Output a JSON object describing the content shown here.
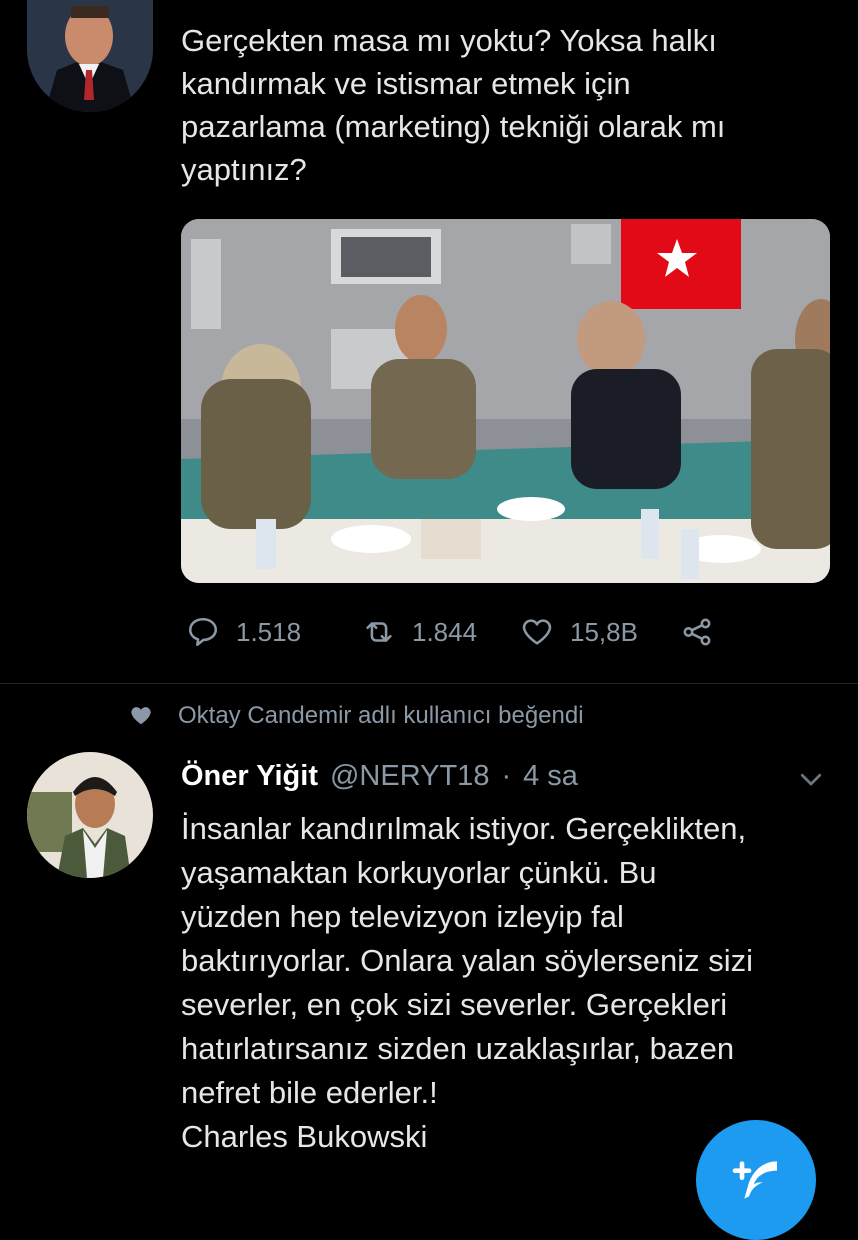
{
  "tweet1": {
    "text": "Gerçekten masa mı yoktu? Yoksa halkı\nkandırmak ve istismar etmek için\npazarlama (marketing) tekniği olarak mı\nyaptınız?",
    "stats": {
      "replies": "1.518",
      "retweets": "1.844",
      "likes": "15,8B"
    },
    "media_icon": "photo",
    "avatar_icon": "user-avatar"
  },
  "social_context": {
    "text": "Oktay Candemir adlı kullanıcı beğendi",
    "icon": "heart-icon"
  },
  "tweet2": {
    "name": "Öner Yiğit",
    "handle": "@NERYT18",
    "separator": "·",
    "time": "4 sa",
    "text": "İnsanlar kandırılmak istiyor. Gerçeklikten,\nyaşamaktan korkuyorlar çünkü. Bu\nyüzden hep televizyon izleyip fal\nbaktırıyorlar. Onlara yalan söylerseniz sizi\nseverler, en çok sizi severler. Gerçekleri\nhatırlatırsanız sizden uzaklaşırlar, bazen\nnefret bile ederler.!\nCharles Bukowski"
  },
  "fab": {
    "icon": "compose-plus-feather-icon"
  },
  "colors": {
    "background": "#000000",
    "text": "#e6e6e6",
    "muted": "#8b98a5",
    "accent": "#1d9bf0",
    "flag": "#e30a17"
  }
}
